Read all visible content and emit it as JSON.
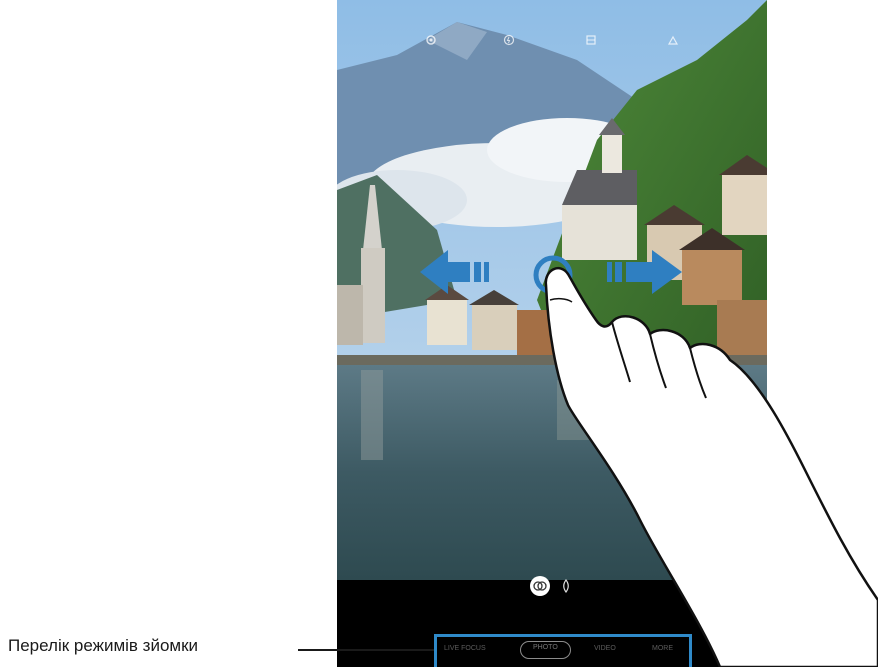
{
  "callout": {
    "label": "Перелік режимів зйомки"
  },
  "top_icons": [
    "settings-icon",
    "flash-icon",
    "timer-icon",
    "ratio-icon"
  ],
  "modes": {
    "items": [
      "LIVE FOCUS",
      "PHOTO",
      "VIDEO",
      "MORE"
    ],
    "active_index": 1
  },
  "colors": {
    "accent": "#2f8ac9",
    "arrow": "#2f7fc1",
    "panel": "#000000"
  }
}
